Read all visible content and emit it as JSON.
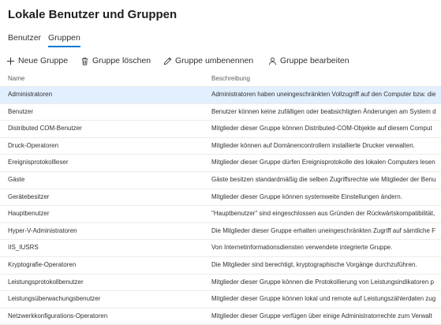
{
  "page": {
    "title": "Lokale Benutzer und Gruppen"
  },
  "tabs": [
    {
      "label": "Benutzer",
      "active": false
    },
    {
      "label": "Gruppen",
      "active": true
    }
  ],
  "toolbar": {
    "new_group": "Neue Gruppe",
    "delete_group": "Gruppe löschen",
    "rename_group": "Gruppe umbenennen",
    "edit_group": "Gruppe bearbeiten"
  },
  "table": {
    "columns": [
      "Name",
      "Beschreibung"
    ],
    "selected_row": 0,
    "rows": [
      {
        "name": "Administratoren",
        "description": "Administratoren haben uneingeschränkten Vollzugriff auf den Computer bzw. die"
      },
      {
        "name": "Benutzer",
        "description": "Benutzer können keine zufälligen oder beabsichtigten Änderungen am System d"
      },
      {
        "name": "Distributed COM-Benutzer",
        "description": "Mitglieder dieser Gruppe können Distributed-COM-Objekte auf diesem Comput"
      },
      {
        "name": "Druck-Operatoren",
        "description": "Mitglieder können auf Domänencontrollern installierte Drucker verwalten."
      },
      {
        "name": "Ereignisprotokollleser",
        "description": "Mitglieder dieser Gruppe dürfen Ereignisprotokolle des lokalen Computers lesen"
      },
      {
        "name": "Gäste",
        "description": "Gäste besitzen standardmäßig die selben Zugriffsrechte wie Mitglieder der Benu"
      },
      {
        "name": "Gerätebesitzer",
        "description": "Mitglieder dieser Gruppe können systemweite Einstellungen ändern."
      },
      {
        "name": "Hauptbenutzer",
        "description": "\"Hauptbenutzer\" sind eingeschlossen aus Gründen der Rückwärtskompatibilität,"
      },
      {
        "name": "Hyper-V-Administratoren",
        "description": "Die Mitglieder dieser Gruppe erhalten uneingeschränkten Zugriff auf sämtliche F"
      },
      {
        "name": "IIS_IUSRS",
        "description": "Von Internetinformationsdiensten verwendete integrierte Gruppe."
      },
      {
        "name": "Kryptografie-Operatoren",
        "description": "Die Mitglieder sind berechtigt, kryptographische Vorgänge durchzuführen."
      },
      {
        "name": "Leistungsprotokollbenutzer",
        "description": "Mitglieder dieser Gruppe können die Protokollierung von Leistungsindikatoren p"
      },
      {
        "name": "Leistungsüberwachungsbenutzer",
        "description": "Mitglieder dieser Gruppe können lokal und remote auf Leistungszählerdaten zug"
      },
      {
        "name": "Netzwerkkonfigurations-Operatoren",
        "description": "Mitglieder dieser Gruppe verfügen über einige Administratorrechte zum Verwalt"
      }
    ]
  },
  "colors": {
    "accent": "#0078d4",
    "selected_row": "#e1efff",
    "divider": "#edebe9"
  },
  "icons": {
    "new": "plus-icon",
    "delete": "trash-icon",
    "rename": "pencil-icon",
    "edit": "person-icon"
  }
}
